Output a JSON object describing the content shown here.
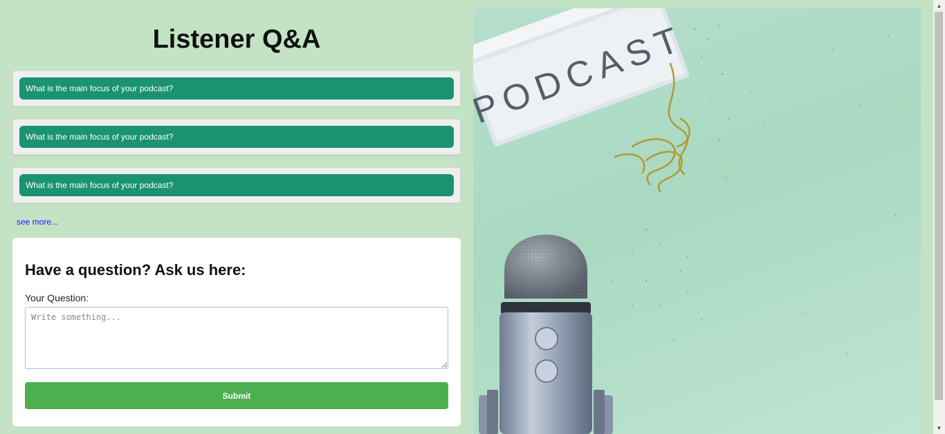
{
  "page": {
    "title": "Listener Q&A"
  },
  "faq": {
    "items": [
      {
        "question": "What is the main focus of your podcast?"
      },
      {
        "question": "What is the main focus of your podcast?"
      },
      {
        "question": "What is the main focus of your podcast?"
      }
    ],
    "see_more_label": "see more..."
  },
  "form": {
    "title": "Have a question? Ask us here:",
    "question_label": "Your Question:",
    "question_placeholder": "Write something...",
    "question_value": "",
    "submit_label": "Submit"
  },
  "hero": {
    "lightbox_text": "PODCAST",
    "colors": {
      "background": "#b6dfcc",
      "microphone": "#9aa7ba",
      "lightbox": "#eef1f4"
    }
  },
  "colors": {
    "page_background": "#c4e3c4",
    "question_bar": "#1a9470",
    "submit_button": "#4caf50",
    "link": "#1a1aff"
  }
}
